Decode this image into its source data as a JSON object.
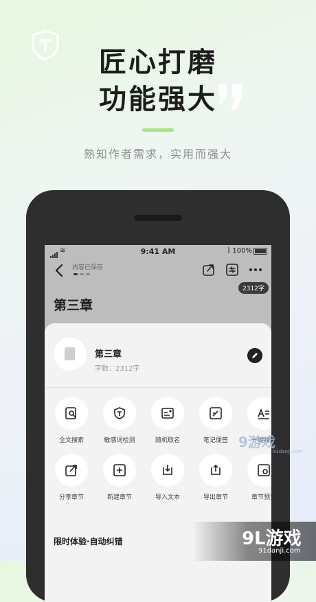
{
  "promo": {
    "headline_line1": "匠心打磨",
    "headline_line2": "功能强大",
    "tagline": "熟知作者需求，实用而强大",
    "accent_color": "#a6e58a"
  },
  "status_bar": {
    "time": "9:41 AM",
    "battery": "100%"
  },
  "editor": {
    "save_status": "内容已保存",
    "word_count_badge": "2312字",
    "chapter_title": "第三章"
  },
  "sheet": {
    "doc_name": "第三章",
    "doc_word_count": "字数：2312字",
    "tools_row1": [
      {
        "label": "全文搜索",
        "icon": "search-doc-icon"
      },
      {
        "label": "敏感词检测",
        "icon": "shield-t-icon"
      },
      {
        "label": "随机取名",
        "icon": "name-card-icon"
      },
      {
        "label": "笔记便签",
        "icon": "note-edit-icon"
      },
      {
        "label": "一键排版",
        "icon": "format-icon"
      }
    ],
    "tools_row2": [
      {
        "label": "分享章节",
        "icon": "share-icon"
      },
      {
        "label": "新建章节",
        "icon": "new-chapter-icon"
      },
      {
        "label": "导入文本",
        "icon": "import-icon"
      },
      {
        "label": "导出章节",
        "icon": "export-icon"
      },
      {
        "label": "章节预览",
        "icon": "preview-icon"
      }
    ],
    "section_title": "限时体验·自动纠错"
  },
  "watermarks": {
    "mid_text": "游戏",
    "mid_logo": "9",
    "mid_sub": "91danji.com",
    "bottom_text": "9L游戏",
    "bottom_sub": "91danji.com"
  }
}
